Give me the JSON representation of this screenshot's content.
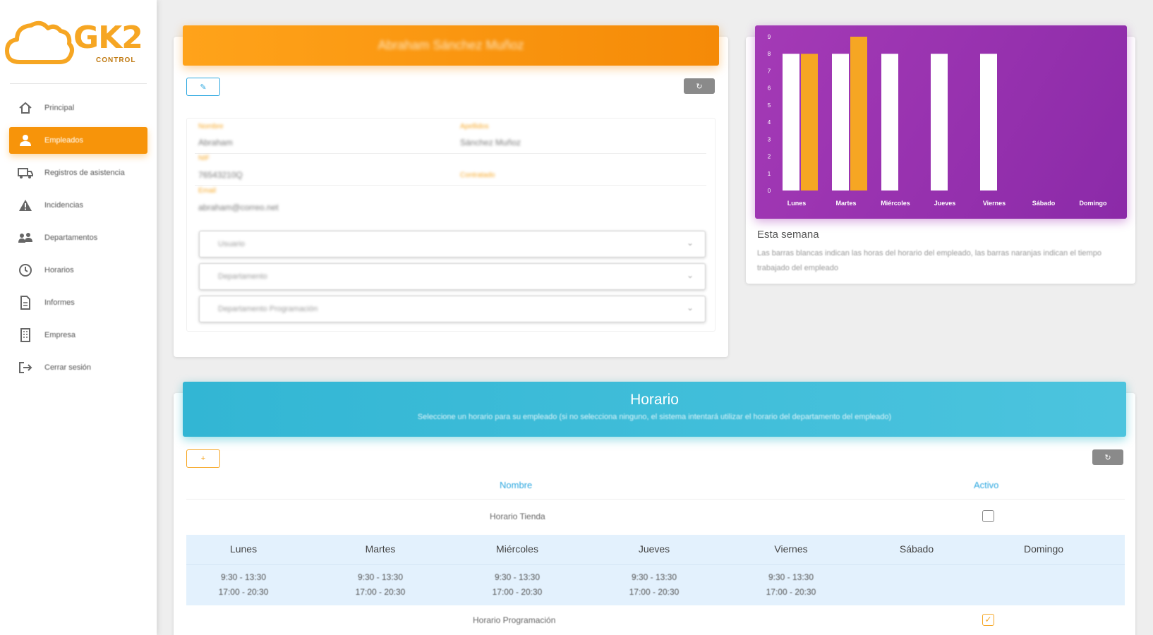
{
  "logo": {
    "text": "GK2",
    "subtext": "CONTROL"
  },
  "sidebar": {
    "items": [
      {
        "label": "Principal",
        "icon": "home-icon",
        "active": false
      },
      {
        "label": "Empleados",
        "icon": "user-icon",
        "active": true
      },
      {
        "label": "Registros de asistencia",
        "icon": "truck-icon",
        "active": false
      },
      {
        "label": "Incidencias",
        "icon": "warning-icon",
        "active": false
      },
      {
        "label": "Departamentos",
        "icon": "group-icon",
        "active": false
      },
      {
        "label": "Horarios",
        "icon": "clock-icon",
        "active": false
      },
      {
        "label": "Informes",
        "icon": "document-icon",
        "active": false
      },
      {
        "label": "Empresa",
        "icon": "building-icon",
        "active": false
      },
      {
        "label": "Cerrar sesión",
        "icon": "logout-icon",
        "active": false
      }
    ]
  },
  "profile": {
    "name": "Abraham Sánchez Muñoz",
    "edit_icon": "✎",
    "refresh_icon": "↻",
    "fields": {
      "nombre_label": "Nombre",
      "nombre_value": "Abraham",
      "apellidos_label": "Apellidos",
      "apellidos_value": "Sánchez Muñoz",
      "nif_label": "NIF",
      "nif_value": "76543210Q",
      "contratado_label": "Contratado",
      "email_label": "Email",
      "email_value": "abraham@correo.net"
    },
    "selects": [
      {
        "value": "Usuario"
      },
      {
        "value": "Departamento"
      },
      {
        "value": "Departamento Programación"
      }
    ]
  },
  "chart_data": {
    "type": "bar",
    "categories": [
      "Lunes",
      "Martes",
      "Miércoles",
      "Jueves",
      "Viernes",
      "Sábado",
      "Domingo"
    ],
    "series": [
      {
        "color": "#ffffff",
        "values": [
          8,
          8,
          8,
          8,
          8,
          0,
          0
        ]
      },
      {
        "color": "#f6a623",
        "values": [
          8,
          9,
          0,
          0,
          0,
          0,
          0
        ]
      }
    ],
    "ylim": [
      0,
      9
    ],
    "yticks": [
      0,
      1,
      2,
      3,
      4,
      5,
      6,
      7,
      8,
      9
    ],
    "title": "Esta semana",
    "description": "Las barras blancas indican las horas del horario del empleado, las barras naranjas indican el tiempo trabajado del empleado"
  },
  "schedule": {
    "title": "Horario",
    "subtitle": "Seleccione un horario para su empleado (si no selecciona ninguno, el sistema intentará utilizar el horario del departamento del empleado)",
    "add_icon": "+",
    "refresh_icon": "↻",
    "col_nombre": "Nombre",
    "col_activo": "Activo",
    "rows": [
      {
        "name": "Horario Tienda",
        "active": false
      },
      {
        "name": "Horario Programación",
        "active": true
      }
    ],
    "days": [
      {
        "name": "Lunes",
        "t1": "9:30 - 13:30",
        "t2": "17:00 - 20:30"
      },
      {
        "name": "Martes",
        "t1": "9:30 - 13:30",
        "t2": "17:00 - 20:30"
      },
      {
        "name": "Miércoles",
        "t1": "9:30 - 13:30",
        "t2": "17:00 - 20:30"
      },
      {
        "name": "Jueves",
        "t1": "9:30 - 13:30",
        "t2": "17:00 - 20:30"
      },
      {
        "name": "Viernes",
        "t1": "9:30 - 13:30",
        "t2": "17:00 - 20:30"
      },
      {
        "name": "Sábado",
        "t1": "",
        "t2": ""
      },
      {
        "name": "Domingo",
        "t1": "",
        "t2": ""
      }
    ],
    "check_mark": "✓"
  }
}
